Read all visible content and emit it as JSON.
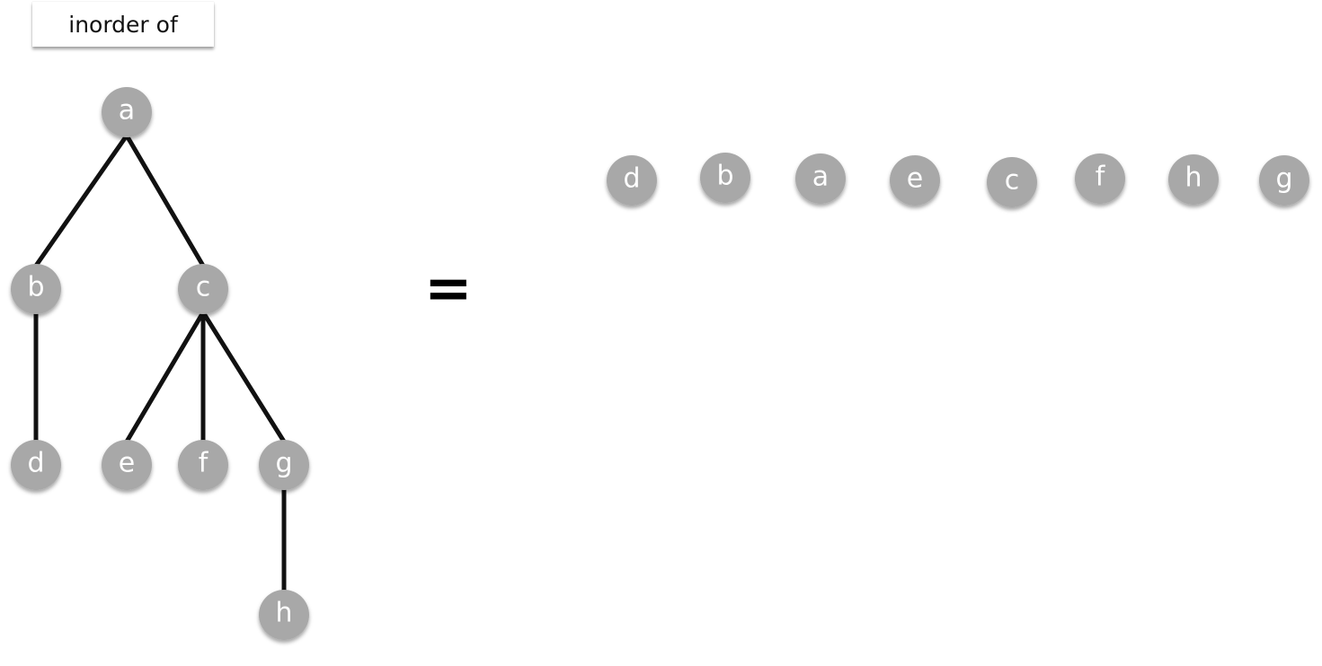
{
  "title": "inorder of",
  "equals_sign": "=",
  "colors": {
    "node_fill": "#a8a8a8",
    "node_text": "#ffffff",
    "edge": "#111111"
  },
  "tree": {
    "nodes": [
      {
        "id": "a",
        "label": "a"
      },
      {
        "id": "b",
        "label": "b"
      },
      {
        "id": "c",
        "label": "c"
      },
      {
        "id": "d",
        "label": "d"
      },
      {
        "id": "e",
        "label": "e"
      },
      {
        "id": "f",
        "label": "f"
      },
      {
        "id": "g",
        "label": "g"
      },
      {
        "id": "h",
        "label": "h"
      }
    ],
    "edges": [
      [
        "a",
        "b"
      ],
      [
        "a",
        "c"
      ],
      [
        "b",
        "d"
      ],
      [
        "c",
        "e"
      ],
      [
        "c",
        "f"
      ],
      [
        "c",
        "g"
      ],
      [
        "g",
        "h"
      ]
    ]
  },
  "traversal": [
    "d",
    "b",
    "a",
    "e",
    "c",
    "f",
    "h",
    "g"
  ]
}
